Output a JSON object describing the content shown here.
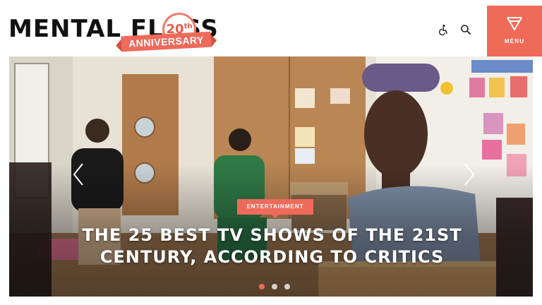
{
  "header": {
    "logo": {
      "wordmark": "MENTAL FLOSS",
      "badge_number": "20",
      "badge_suffix": "th",
      "badge_ribbon": "ANNIVERSARY"
    },
    "icons": [
      "accessibility-icon",
      "search-icon"
    ],
    "menu_label": "MENU"
  },
  "hero": {
    "category": "ENTERTAINMENT",
    "headline": "THE 25 BEST TV SHOWS OF THE 21ST CENTURY, ACCORDING TO CRITICS",
    "slide_count": 3,
    "active_slide": 1
  },
  "colors": {
    "accent": "#f06b57",
    "ribbon": "#ee6a5a",
    "text_dark": "#111111"
  }
}
